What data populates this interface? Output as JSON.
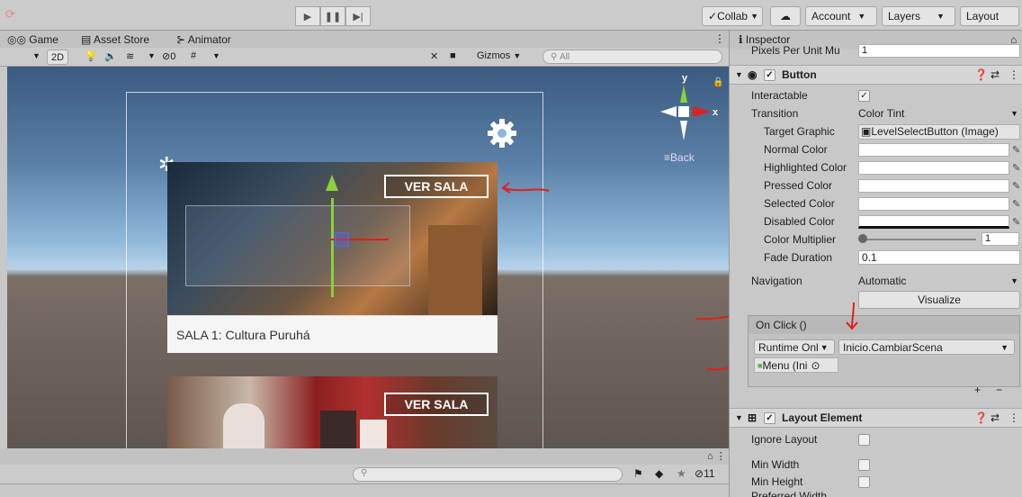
{
  "toolbar": {
    "collab": "Collab",
    "account": "Account",
    "layers": "Layers",
    "layout": "Layout"
  },
  "game_tabs": {
    "game": "Game",
    "asset_store": "Asset Store",
    "animator": "Animator"
  },
  "game_bar": {
    "mode_2d": "2D",
    "gizmos": "Gizmos",
    "search_placeholder": "All",
    "hidden_count": "0"
  },
  "scene": {
    "back_label": "Back",
    "gizmo_y": "y",
    "gizmo_x": "x",
    "card1": {
      "button": "VER SALA",
      "title": "SALA 1: Cultura Puruhá"
    },
    "card2": {
      "button": "VER SALA"
    }
  },
  "console": {
    "count": "11"
  },
  "inspector": {
    "tab": "Inspector",
    "top_field_label": "Pixels Per Unit Mu",
    "top_field_value": "1",
    "button_component": "Button",
    "interactable_label": "Interactable",
    "transition_label": "Transition",
    "transition_value": "Color Tint",
    "target_graphic_label": "Target Graphic",
    "target_graphic_value": "LevelSelectButton (Image)",
    "normal_color": "Normal Color",
    "highlighted_color": "Highlighted Color",
    "pressed_color": "Pressed Color",
    "selected_color": "Selected Color",
    "disabled_color": "Disabled Color",
    "color_multiplier_label": "Color Multiplier",
    "color_multiplier_value": "1",
    "fade_duration_label": "Fade Duration",
    "fade_duration_value": "0.1",
    "navigation_label": "Navigation",
    "navigation_value": "Automatic",
    "visualize": "Visualize",
    "onclick_header": "On Click ()",
    "runtime": "Runtime Onl",
    "function": "Inicio.CambiarScena",
    "object_ref": "Menu (Ini",
    "layout_element": "Layout Element",
    "ignore_layout": "Ignore Layout",
    "min_width": "Min Width",
    "min_height": "Min Height",
    "preferred_width": "Preferred Width"
  },
  "colors": {
    "accent_red": "#e0201c",
    "panel": "#c8c8c8"
  }
}
